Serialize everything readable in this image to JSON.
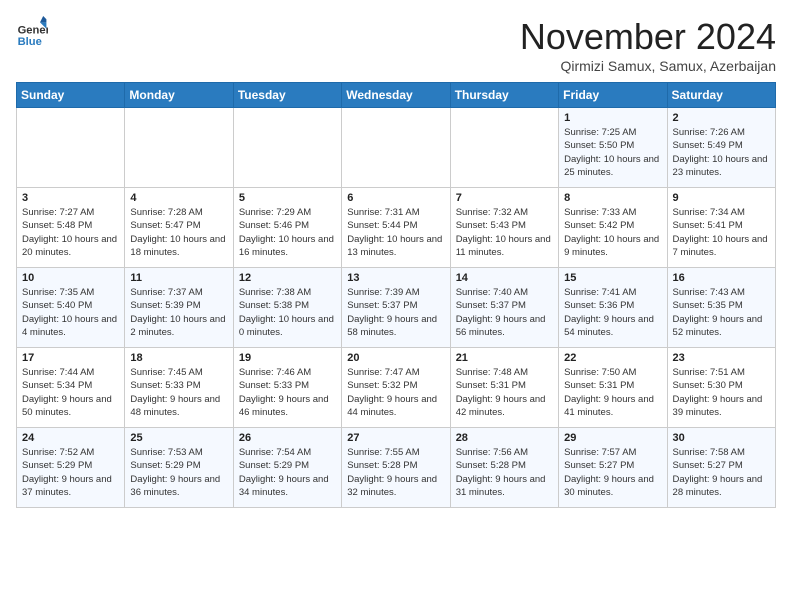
{
  "logo": {
    "general": "General",
    "blue": "Blue"
  },
  "header": {
    "month": "November 2024",
    "location": "Qirmizi Samux, Samux, Azerbaijan"
  },
  "weekdays": [
    "Sunday",
    "Monday",
    "Tuesday",
    "Wednesday",
    "Thursday",
    "Friday",
    "Saturday"
  ],
  "weeks": [
    [
      {
        "day": "",
        "text": ""
      },
      {
        "day": "",
        "text": ""
      },
      {
        "day": "",
        "text": ""
      },
      {
        "day": "",
        "text": ""
      },
      {
        "day": "",
        "text": ""
      },
      {
        "day": "1",
        "text": "Sunrise: 7:25 AM\nSunset: 5:50 PM\nDaylight: 10 hours and 25 minutes."
      },
      {
        "day": "2",
        "text": "Sunrise: 7:26 AM\nSunset: 5:49 PM\nDaylight: 10 hours and 23 minutes."
      }
    ],
    [
      {
        "day": "3",
        "text": "Sunrise: 7:27 AM\nSunset: 5:48 PM\nDaylight: 10 hours and 20 minutes."
      },
      {
        "day": "4",
        "text": "Sunrise: 7:28 AM\nSunset: 5:47 PM\nDaylight: 10 hours and 18 minutes."
      },
      {
        "day": "5",
        "text": "Sunrise: 7:29 AM\nSunset: 5:46 PM\nDaylight: 10 hours and 16 minutes."
      },
      {
        "day": "6",
        "text": "Sunrise: 7:31 AM\nSunset: 5:44 PM\nDaylight: 10 hours and 13 minutes."
      },
      {
        "day": "7",
        "text": "Sunrise: 7:32 AM\nSunset: 5:43 PM\nDaylight: 10 hours and 11 minutes."
      },
      {
        "day": "8",
        "text": "Sunrise: 7:33 AM\nSunset: 5:42 PM\nDaylight: 10 hours and 9 minutes."
      },
      {
        "day": "9",
        "text": "Sunrise: 7:34 AM\nSunset: 5:41 PM\nDaylight: 10 hours and 7 minutes."
      }
    ],
    [
      {
        "day": "10",
        "text": "Sunrise: 7:35 AM\nSunset: 5:40 PM\nDaylight: 10 hours and 4 minutes."
      },
      {
        "day": "11",
        "text": "Sunrise: 7:37 AM\nSunset: 5:39 PM\nDaylight: 10 hours and 2 minutes."
      },
      {
        "day": "12",
        "text": "Sunrise: 7:38 AM\nSunset: 5:38 PM\nDaylight: 10 hours and 0 minutes."
      },
      {
        "day": "13",
        "text": "Sunrise: 7:39 AM\nSunset: 5:37 PM\nDaylight: 9 hours and 58 minutes."
      },
      {
        "day": "14",
        "text": "Sunrise: 7:40 AM\nSunset: 5:37 PM\nDaylight: 9 hours and 56 minutes."
      },
      {
        "day": "15",
        "text": "Sunrise: 7:41 AM\nSunset: 5:36 PM\nDaylight: 9 hours and 54 minutes."
      },
      {
        "day": "16",
        "text": "Sunrise: 7:43 AM\nSunset: 5:35 PM\nDaylight: 9 hours and 52 minutes."
      }
    ],
    [
      {
        "day": "17",
        "text": "Sunrise: 7:44 AM\nSunset: 5:34 PM\nDaylight: 9 hours and 50 minutes."
      },
      {
        "day": "18",
        "text": "Sunrise: 7:45 AM\nSunset: 5:33 PM\nDaylight: 9 hours and 48 minutes."
      },
      {
        "day": "19",
        "text": "Sunrise: 7:46 AM\nSunset: 5:33 PM\nDaylight: 9 hours and 46 minutes."
      },
      {
        "day": "20",
        "text": "Sunrise: 7:47 AM\nSunset: 5:32 PM\nDaylight: 9 hours and 44 minutes."
      },
      {
        "day": "21",
        "text": "Sunrise: 7:48 AM\nSunset: 5:31 PM\nDaylight: 9 hours and 42 minutes."
      },
      {
        "day": "22",
        "text": "Sunrise: 7:50 AM\nSunset: 5:31 PM\nDaylight: 9 hours and 41 minutes."
      },
      {
        "day": "23",
        "text": "Sunrise: 7:51 AM\nSunset: 5:30 PM\nDaylight: 9 hours and 39 minutes."
      }
    ],
    [
      {
        "day": "24",
        "text": "Sunrise: 7:52 AM\nSunset: 5:29 PM\nDaylight: 9 hours and 37 minutes."
      },
      {
        "day": "25",
        "text": "Sunrise: 7:53 AM\nSunset: 5:29 PM\nDaylight: 9 hours and 36 minutes."
      },
      {
        "day": "26",
        "text": "Sunrise: 7:54 AM\nSunset: 5:29 PM\nDaylight: 9 hours and 34 minutes."
      },
      {
        "day": "27",
        "text": "Sunrise: 7:55 AM\nSunset: 5:28 PM\nDaylight: 9 hours and 32 minutes."
      },
      {
        "day": "28",
        "text": "Sunrise: 7:56 AM\nSunset: 5:28 PM\nDaylight: 9 hours and 31 minutes."
      },
      {
        "day": "29",
        "text": "Sunrise: 7:57 AM\nSunset: 5:27 PM\nDaylight: 9 hours and 30 minutes."
      },
      {
        "day": "30",
        "text": "Sunrise: 7:58 AM\nSunset: 5:27 PM\nDaylight: 9 hours and 28 minutes."
      }
    ]
  ]
}
